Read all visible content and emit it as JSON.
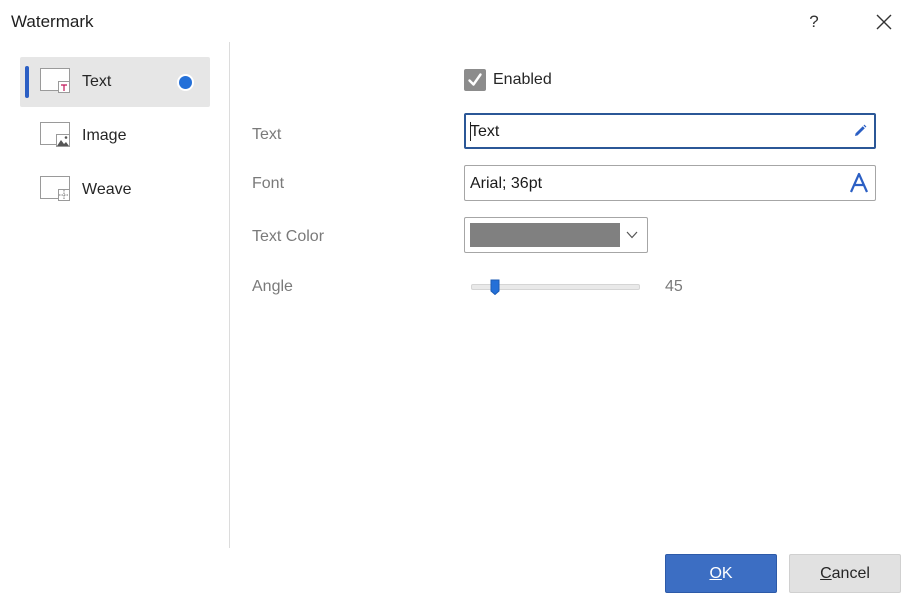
{
  "window": {
    "title": "Watermark",
    "help_label": "?",
    "help_icon": "question-mark",
    "close_icon": "close-x"
  },
  "sidebar": {
    "items": [
      {
        "label": "Text",
        "icon": "text-watermark-thumbnail",
        "selected": true
      },
      {
        "label": "Image",
        "icon": "image-watermark-thumbnail",
        "selected": false
      },
      {
        "label": "Weave",
        "icon": "weave-watermark-thumbnail",
        "selected": false
      }
    ]
  },
  "form": {
    "enabled": {
      "label": "Enabled",
      "checked": true
    },
    "text": {
      "label": "Text",
      "value": "Text",
      "icon": "pencil-icon"
    },
    "font": {
      "label": "Font",
      "value": "Arial; 36pt",
      "icon": "font-a-icon"
    },
    "text_color": {
      "label": "Text Color",
      "value": "#808080"
    },
    "angle": {
      "label": "Angle",
      "value": "45",
      "min": 0,
      "max": 360
    }
  },
  "buttons": {
    "ok": {
      "mnemonic": "O",
      "rest": "K"
    },
    "cancel": {
      "mnemonic": "C",
      "rest": "ancel"
    }
  },
  "colors": {
    "accent": "#2b5fc4",
    "primary_button": "#3c6ec3",
    "radio_selected": "#2470d8",
    "checkbox_checked": "#8c8c8c",
    "selected_item_bg": "#e6e6e6"
  }
}
